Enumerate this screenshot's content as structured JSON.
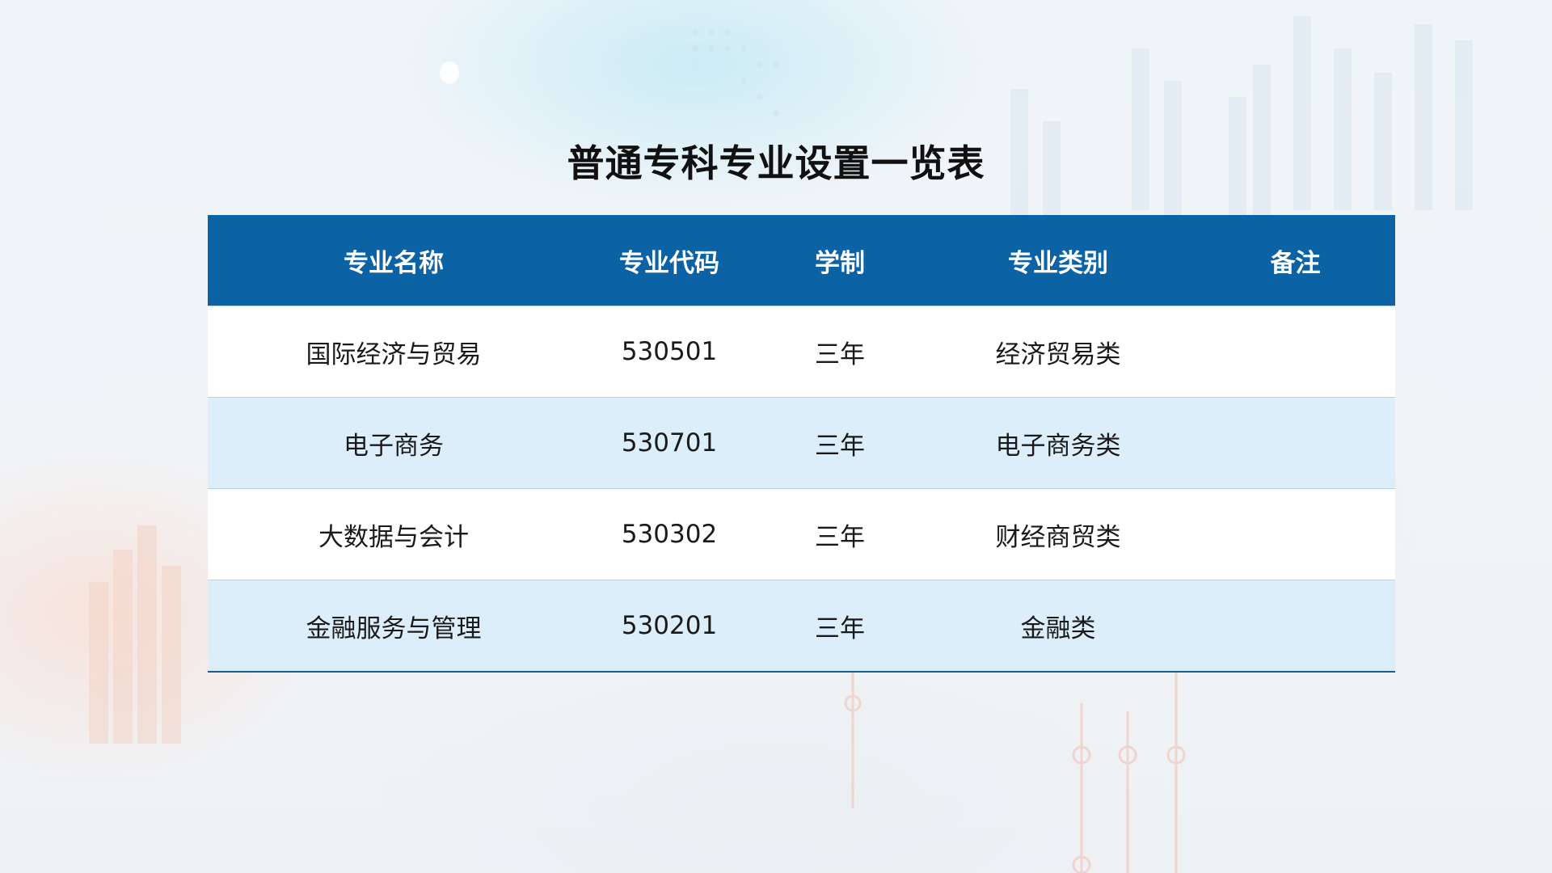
{
  "title": "普通专科专业设置一览表",
  "table": {
    "headers": [
      "专业名称",
      "专业代码",
      "学制",
      "专业类别",
      "备注"
    ],
    "rows": [
      [
        "国际经济与贸易",
        "530501",
        "三年",
        "经济贸易类",
        ""
      ],
      [
        "电子商务",
        "530701",
        "三年",
        "电子商务类",
        ""
      ],
      [
        "大数据与会计",
        "530302",
        "三年",
        "财经商贸类",
        ""
      ],
      [
        "金融服务与管理",
        "530201",
        "三年",
        "金融类",
        ""
      ]
    ]
  },
  "colors": {
    "header_bg": "#0b62a4",
    "header_text": "#ffffff",
    "row_alt_bg": "#ddeefb",
    "row_bg": "#ffffff"
  }
}
